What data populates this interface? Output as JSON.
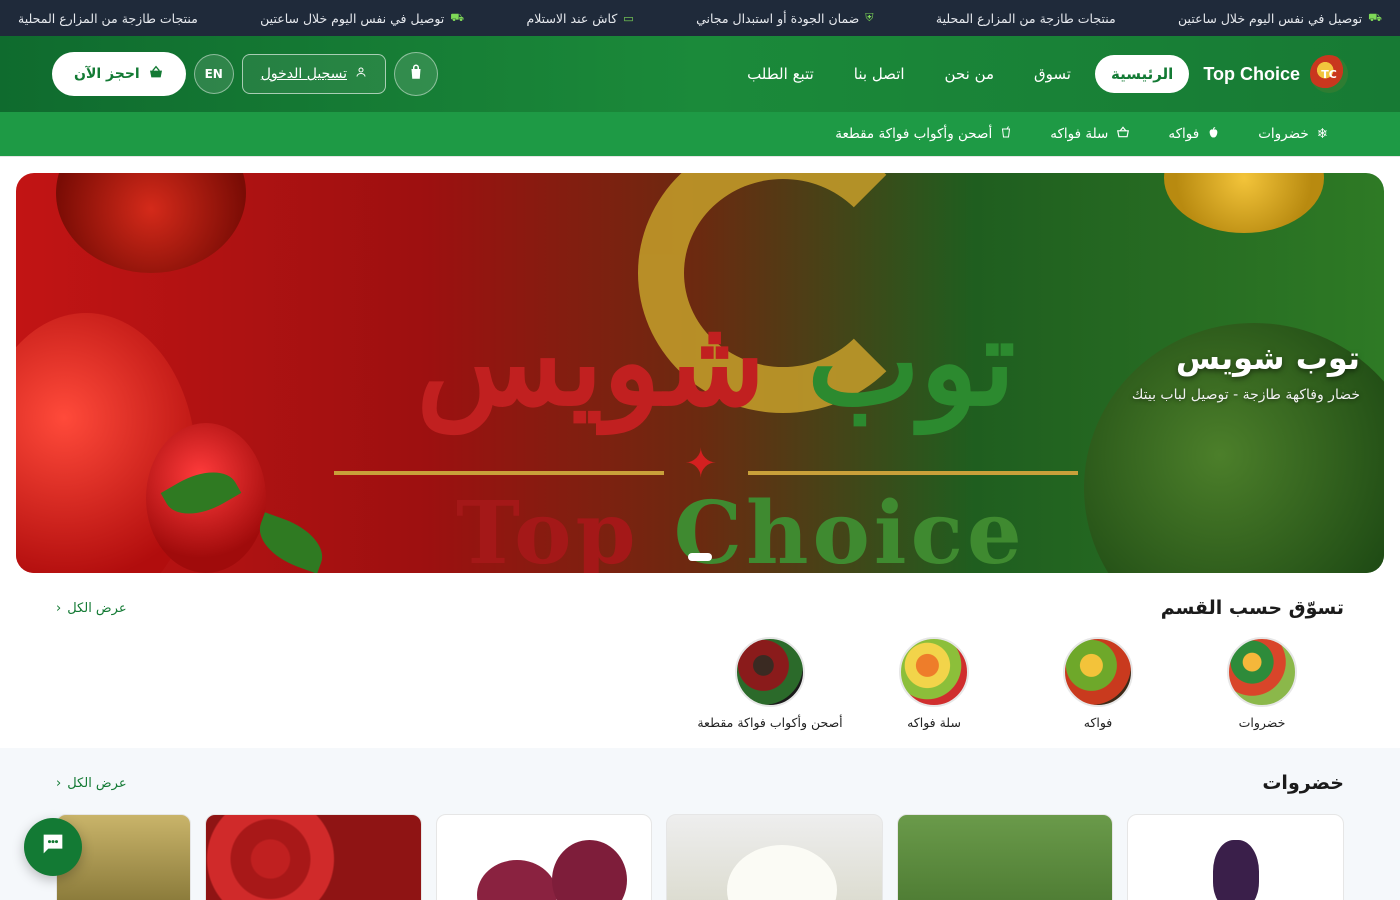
{
  "topbar": {
    "items": [
      {
        "icon": "truck-icon",
        "text": "توصيل في نفس اليوم خلال ساعتين"
      },
      {
        "icon": "",
        "text": "منتجات طازجة من المزارع المحلية"
      },
      {
        "icon": "shield-icon",
        "text": "ضمان الجودة أو استبدال مجاني"
      },
      {
        "icon": "cash-icon",
        "text": "كاش عند الاستلام"
      },
      {
        "icon": "truck-icon",
        "text": "توصيل في نفس اليوم خلال ساعتين"
      },
      {
        "icon": "",
        "text": "منتجات طازجة من المزارع المحلية"
      }
    ]
  },
  "header": {
    "brand": "Top Choice",
    "logo_text": "TC",
    "nav": [
      "الرئيسية",
      "تسوق",
      "من نحن",
      "اتصل بنا",
      "تتبع الطلب"
    ],
    "login_label": "تسجيل الدخول",
    "lang_label": "EN",
    "book_label": "احجز الآن"
  },
  "categories_bar": [
    {
      "icon": "snowflake-icon",
      "label": "خضروات"
    },
    {
      "icon": "apple-icon",
      "label": "فواكه"
    },
    {
      "icon": "basket-icon",
      "label": "سلة فواكه"
    },
    {
      "icon": "cup-icon",
      "label": "أصحن وأكواب فواكة مقطعة"
    }
  ],
  "hero": {
    "title": "توب شويس",
    "subtitle": "خضار وفاكهة طازجة - توصيل لباب بيتك",
    "logo_ar_1": "توب",
    "logo_ar_2": "شويس",
    "logo_en_1": "Top",
    "logo_en_2": "Choice"
  },
  "shop_by_category": {
    "title": "تسوّق حسب القسم",
    "view_all": "عرض الكل",
    "items": [
      "خضروات",
      "فواكه",
      "سلة فواكه",
      "أصحن وأكواب فواكة مقطعة"
    ]
  },
  "vegetables": {
    "title": "خضروات",
    "view_all": "عرض الكل"
  },
  "colors": {
    "primary": "#137a34",
    "topbar": "#1f2a3a",
    "catbar": "#1e9a45"
  }
}
